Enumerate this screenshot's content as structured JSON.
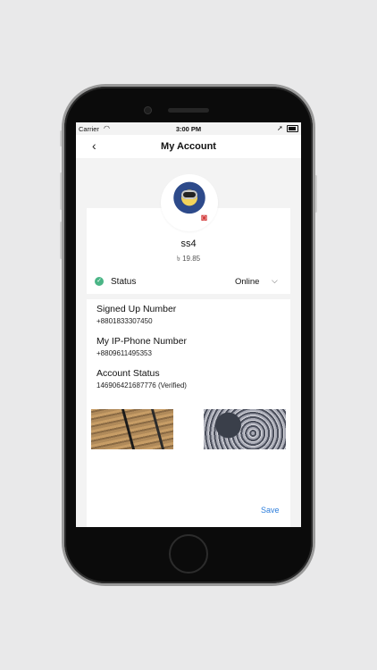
{
  "status_bar": {
    "carrier": "Carrier",
    "time": "3:00 PM"
  },
  "nav": {
    "title": "My Account",
    "back_icon": "chevron-left-icon"
  },
  "profile": {
    "username": "ss4",
    "balance": "৳ 19.85",
    "camera_icon": "camera-icon",
    "accent_color": "#d33a3a"
  },
  "status": {
    "label": "Status",
    "value": "Online",
    "indicator_color": "#4ab586"
  },
  "details": {
    "signed_up_label": "Signed Up Number",
    "signed_up_value": "+8801833307450",
    "ip_phone_label": "My IP-Phone Number",
    "ip_phone_value": "+8809611495353",
    "account_status_label": "Account Status",
    "account_status_value": "146906421687776 (Verified)"
  },
  "actions": {
    "save_label": "Save",
    "save_color": "#2e7fdc"
  }
}
